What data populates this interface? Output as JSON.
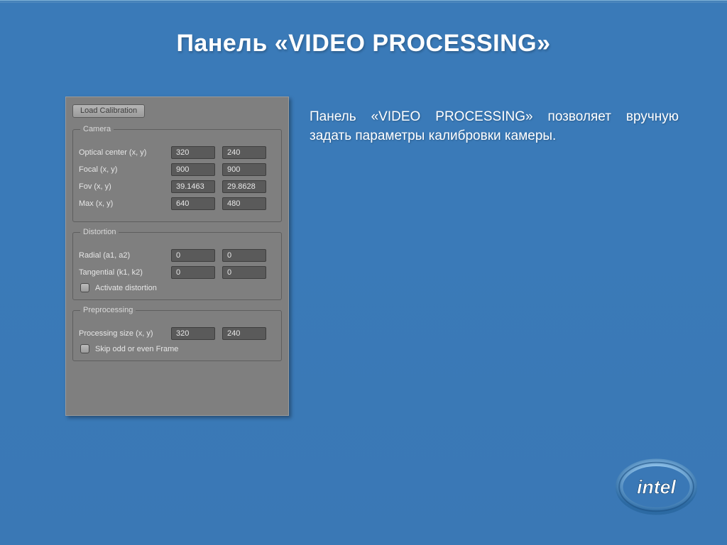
{
  "slide": {
    "title": "Панель «VIDEO PROCESSING»",
    "description": "Панель «VIDEO PROCESSING» позволяет вручную задать параметры калибровки камеры."
  },
  "panel": {
    "load_calibration_label": "Load Calibration",
    "camera": {
      "legend": "Camera",
      "optical_center_label": "Optical center (x, y)",
      "optical_center_x": "320",
      "optical_center_y": "240",
      "focal_label": "Focal (x, y)",
      "focal_x": "900",
      "focal_y": "900",
      "fov_label": "Fov (x, y)",
      "fov_x": "39.1463",
      "fov_y": "29.8628",
      "max_label": "Max (x, y)",
      "max_x": "640",
      "max_y": "480"
    },
    "distortion": {
      "legend": "Distortion",
      "radial_label": "Radial (a1, a2)",
      "radial_a1": "0",
      "radial_a2": "0",
      "tangential_label": "Tangential (k1, k2)",
      "tangential_k1": "0",
      "tangential_k2": "0",
      "activate_label": "Activate distortion"
    },
    "preprocessing": {
      "legend": "Preprocessing",
      "processing_size_label": "Processing size (x, y)",
      "processing_size_x": "320",
      "processing_size_y": "240",
      "skip_label": "Skip odd or even Frame"
    }
  },
  "brand": "intel"
}
